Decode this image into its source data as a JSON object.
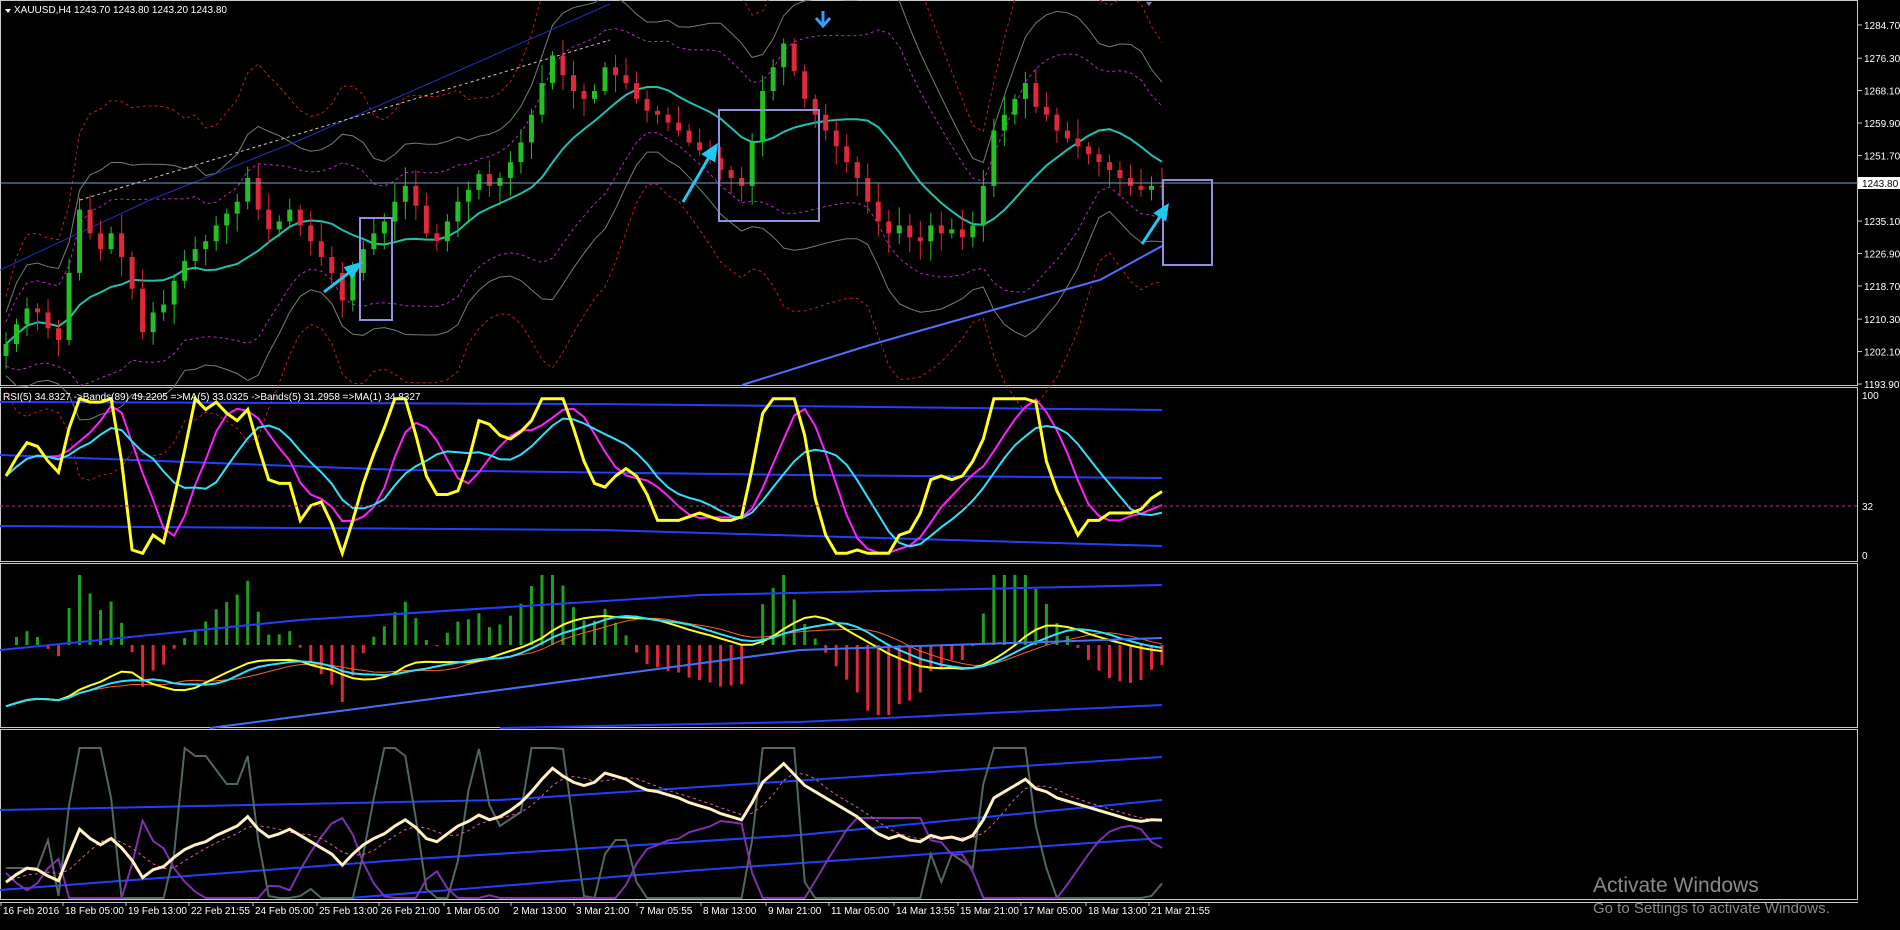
{
  "window": {
    "symbol_header": "XAUUSD,H4  1243.70 1243.80 1243.20 1243.80",
    "current_price_label": "1243.80"
  },
  "price_axis": [
    "1284.70",
    "1276.30",
    "1268.10",
    "1259.90",
    "1251.70",
    "1235.10",
    "1226.90",
    "1218.70",
    "1210.30",
    "1202.10",
    "1193.90"
  ],
  "indicator1": {
    "header": "RSI(5) 34.8327  ->Bands(89) 49.2205  =>MA(5) 33.0325  ->Bands(5) 31.2958  =>MA(1) 34.8327",
    "axis": [
      "100",
      "32",
      "0"
    ]
  },
  "time_axis": [
    "16 Feb 2016",
    "18 Feb 05:00",
    "19 Feb 13:00",
    "22 Feb 21:55",
    "24 Feb 05:00",
    "25 Feb 13:00",
    "26 Feb 21:00",
    "1 Mar 05:00",
    "2 Mar 13:00",
    "3 Mar 21:00",
    "7 Mar 05:55",
    "8 Mar 13:00",
    "9 Mar 21:00",
    "11 Mar 05:00",
    "14 Mar 13:55",
    "15 Mar 21:00",
    "17 Mar 05:00",
    "18 Mar 13:00",
    "21 Mar 21:55"
  ],
  "watermark": {
    "line1": "Activate Windows",
    "line2": "Go to Settings to activate Windows."
  },
  "colors": {
    "bull": "#22c022",
    "bear": "#e0283a",
    "bands": "#20c0b0",
    "rsi": "#ffff20",
    "ma": "#ff20ff",
    "cyan": "#30e0ff",
    "blue": "#2040ff",
    "annotation": "#9090dd",
    "arrow": "#20c8f0"
  },
  "chart_data": {
    "type": "candlestick",
    "symbol": "XAUUSD",
    "timeframe": "H4",
    "close_values": [
      1204,
      1209,
      1213,
      1212,
      1208,
      1205,
      1222,
      1238,
      1232,
      1228,
      1232,
      1226,
      1218,
      1207,
      1212,
      1214,
      1220,
      1225,
      1228,
      1230,
      1234,
      1237,
      1240,
      1246,
      1238,
      1233,
      1235,
      1238,
      1234,
      1230,
      1226,
      1222,
      1215,
      1222,
      1228,
      1232,
      1235,
      1240,
      1244,
      1239,
      1232,
      1230,
      1235,
      1240,
      1243,
      1247,
      1244,
      1246,
      1250,
      1255,
      1262,
      1270,
      1277,
      1272,
      1268,
      1266,
      1268,
      1274,
      1272,
      1270,
      1266,
      1263,
      1262,
      1260,
      1258,
      1255,
      1253,
      1251,
      1248,
      1246,
      1244,
      1255,
      1268,
      1274,
      1280,
      1273,
      1266,
      1262,
      1258,
      1254,
      1250,
      1246,
      1240,
      1235,
      1232,
      1234,
      1231,
      1230,
      1234,
      1232,
      1233,
      1231,
      1234,
      1244,
      1258,
      1262,
      1266,
      1270,
      1264,
      1262,
      1258,
      1256,
      1254,
      1252,
      1250,
      1248,
      1246,
      1244,
      1243,
      1244,
      1243.8
    ],
    "price_range": [
      1193.9,
      1290
    ],
    "rsi_current": 34.8327
  }
}
